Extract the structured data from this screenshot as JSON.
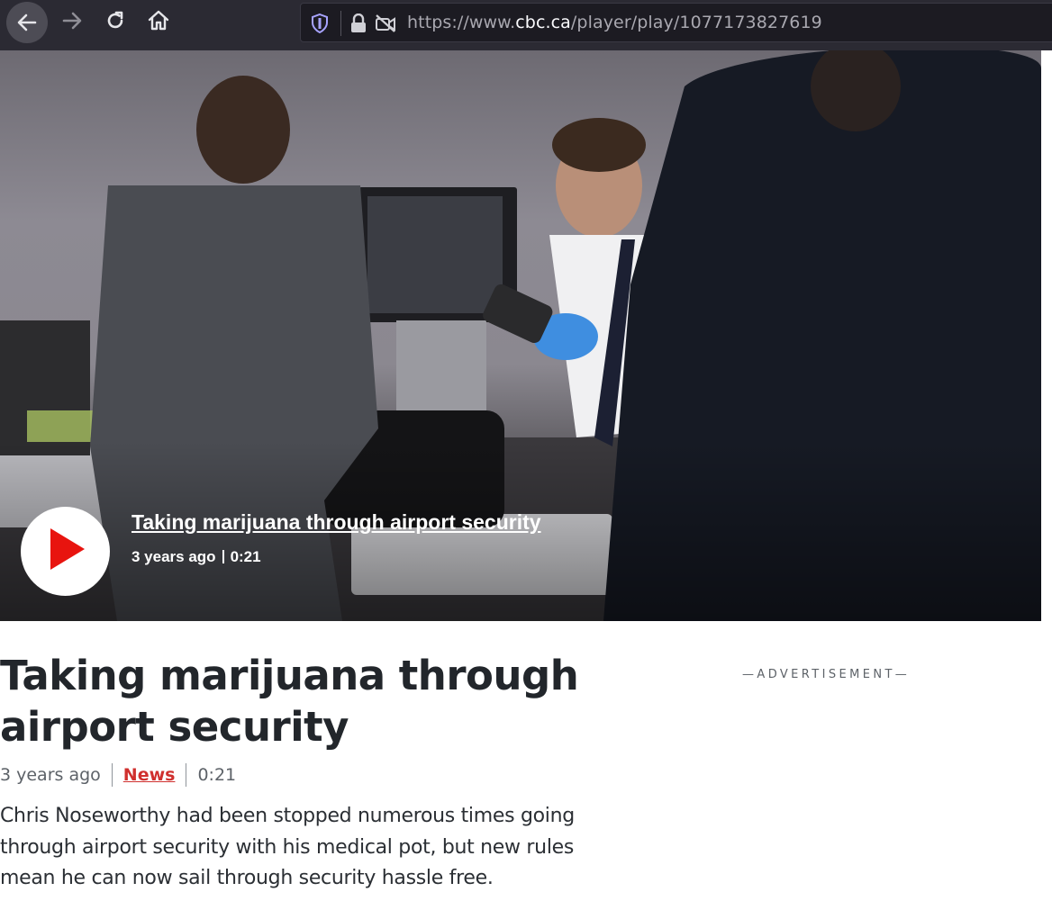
{
  "browser": {
    "url_prefix": "https://www.",
    "url_host": "cbc.ca",
    "url_path": "/player/play/1077173827619",
    "icons": [
      "back-arrow-icon",
      "forward-arrow-icon",
      "reload-icon",
      "home-icon",
      "shield-icon",
      "lock-icon",
      "camera-blocked-icon"
    ]
  },
  "video": {
    "title": "Taking marijuana through airport security",
    "age": "3 years ago",
    "duration": "0:21",
    "play_icon": "play-icon"
  },
  "article": {
    "headline": "Taking marijuana through airport security",
    "age": "3 years ago",
    "category": "News",
    "duration": "0:21",
    "description": "Chris Noseworthy had been stopped numerous times going through airport security with his medical pot, but new rules mean he can now sail through security hassle free."
  },
  "ad": {
    "label": "—ADVERTISEMENT—"
  },
  "colors": {
    "toolbar_bg": "#2b2a33",
    "accent_red": "#d0302e",
    "headline": "#22262b"
  }
}
